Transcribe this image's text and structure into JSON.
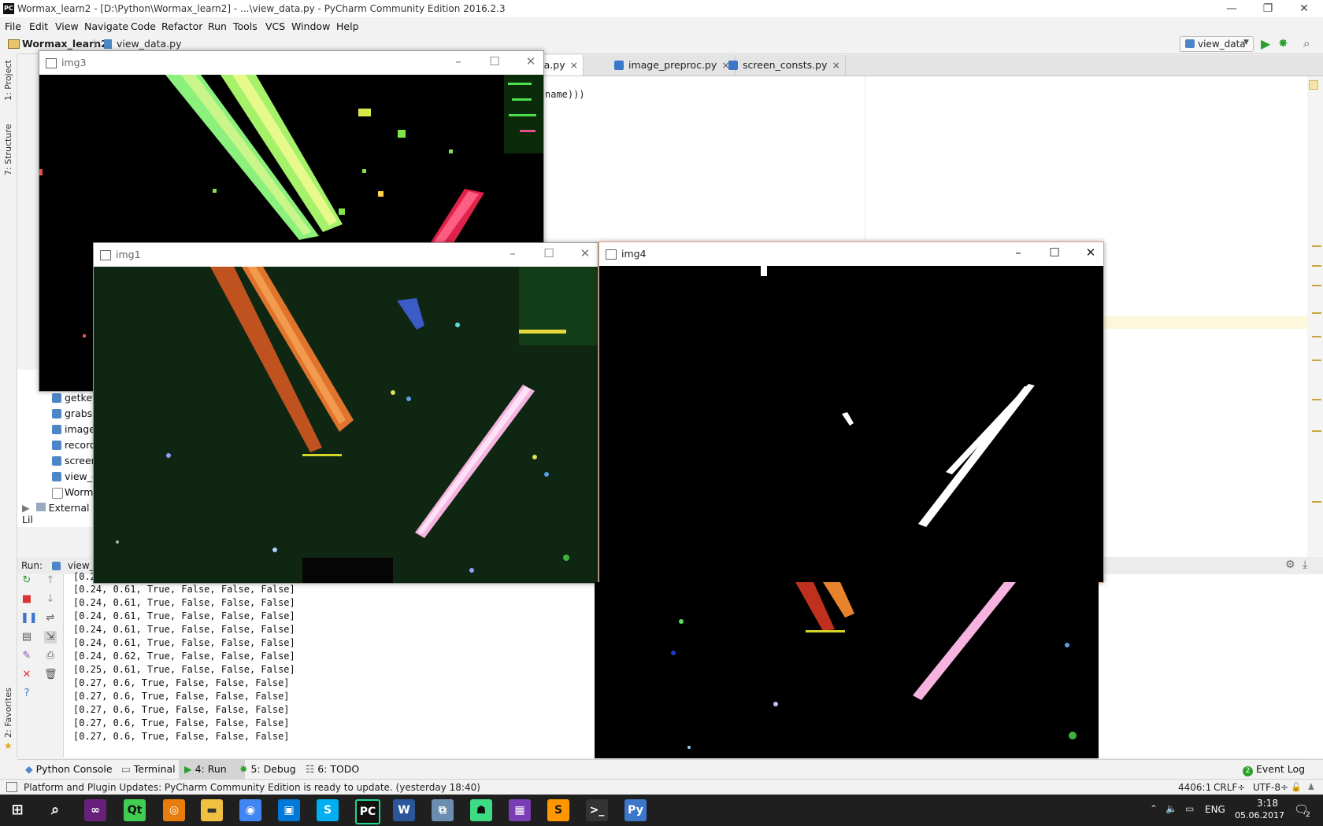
{
  "colors": {
    "accent": "#3d77c9",
    "run_green": "#2aa12a",
    "stop_red": "#d33"
  },
  "window": {
    "title": "Wormax_learn2 - [D:\\Python\\Wormax_learn2] - ...\\view_data.py - PyCharm Community Edition 2016.2.3",
    "logo": "PC"
  },
  "menu": [
    "File",
    "Edit",
    "View",
    "Navigate",
    "Code",
    "Refactor",
    "Run",
    "Tools",
    "VCS",
    "Window",
    "Help"
  ],
  "breadcrumb": {
    "project": "Wormax_learn2",
    "file": "view_data.py"
  },
  "run_config": {
    "label": "view_data"
  },
  "left_strip": {
    "project": "1: Project",
    "structure": "7: Structure",
    "favorites": "2: Favorites"
  },
  "editor_tabs": [
    {
      "label": "ew_data.py",
      "close": "×"
    },
    {
      "label": "image_preproc.py",
      "close": "×"
    },
    {
      "label": "screen_consts.py",
      "close": "×"
    }
  ],
  "editor": {
    "code_fragment": "name)))"
  },
  "tree": {
    "items": [
      "getkey",
      "grabsc",
      "image_",
      "recorde",
      "screen_",
      "view_d",
      "Worma"
    ],
    "external": "External Lil"
  },
  "run_panel": {
    "label": "Run:",
    "tab": "view_d"
  },
  "console": {
    "lines": [
      "[0.24, 0.61, True, False, False, False]",
      "[0.24, 0.61, True, False, False, False]",
      "[0.24, 0.61, True, False, False, False]",
      "[0.24, 0.61, True, False, False, False]",
      "[0.24, 0.61, True, False, False, False]",
      "[0.24, 0.62, True, False, False, False]",
      "[0.25, 0.61, True, False, False, False]",
      "[0.27, 0.6, True, False, False, False]",
      "[0.27, 0.6, True, False, False, False]",
      "[0.27, 0.6, True, False, False, False]",
      "[0.27, 0.6, True, False, False, False]",
      "[0.27, 0.6, True, False, False, False]"
    ],
    "partial_top": "[0.2"
  },
  "tool_tabs": [
    {
      "label": "Python Console"
    },
    {
      "label": "Terminal"
    },
    {
      "label": "4: Run"
    },
    {
      "label": "5: Debug"
    },
    {
      "label": "6: TODO"
    }
  ],
  "event_log": {
    "count": "2",
    "label": "Event Log"
  },
  "status": {
    "message": "Platform and Plugin Updates: PyCharm Community Edition is ready to update. (yesterday 18:40)",
    "position": "4406:1",
    "line_sep": "CRLF÷",
    "encoding": "UTF-8÷"
  },
  "cv_windows": {
    "img3": "img3",
    "img1": "img1",
    "img4": "img4"
  },
  "taskbar": {
    "language": "ENG",
    "time": "3:18",
    "date": "05.06.2017",
    "notif_count": "2",
    "apps": [
      "visual-studio",
      "qt-creator",
      "blender",
      "file-explorer",
      "chrome",
      "store",
      "skype",
      "pycharm",
      "word",
      "network",
      "android",
      "rar",
      "sublime",
      "terminal",
      "python"
    ]
  }
}
